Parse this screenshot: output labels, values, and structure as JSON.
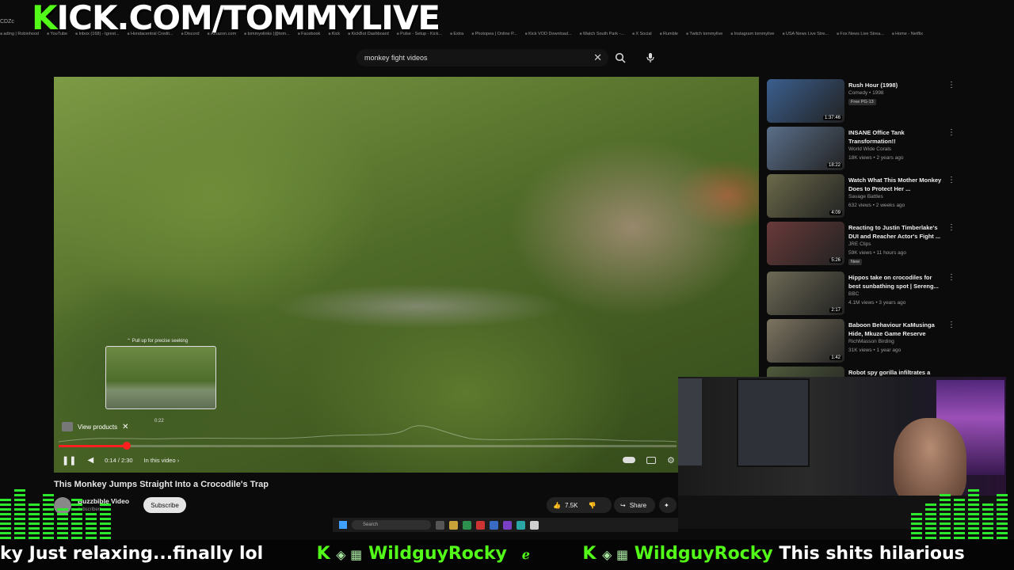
{
  "overlay": {
    "brand_k": "K",
    "brand_rest": "ICK.COM/TOMMYLIVE",
    "corner_text": "CDZc"
  },
  "bookmarks": [
    "ading | Robinhood",
    "YouTube",
    "Inbox (168) - tgrest...",
    "Hondacentral Credit...",
    "Discord",
    "Amazon.com",
    "tommyolinks (@tom...",
    "Facebook",
    "Kick",
    "KickBot Dashboard",
    "Pulse - Setup - Kick...",
    "Extra",
    "Photopea | Online P...",
    "Kick VOD Download...",
    "Watch South Park -...",
    "X Social",
    "Rumble",
    "Twitch tommylive",
    "Instagram tommylive",
    "USA News Live Stre...",
    "Fox News Live Strea...",
    "Home - Netflix"
  ],
  "search": {
    "query": "monkey fight videos"
  },
  "player": {
    "seek_hint": "Pull up for precise seeking",
    "preview_time": "0:22",
    "view_products": "View products",
    "time": "0:14 / 2:30",
    "chapters": "In this video",
    "progress": 0.11
  },
  "video": {
    "title": "This Monkey Jumps Straight Into a Crocodile's Trap",
    "channel": "Buzzbible Video",
    "subscribers": "subscribers",
    "subscribe_label": "Subscribe",
    "likes": "7.5K",
    "share_label": "Share"
  },
  "recommendations": [
    {
      "title": "Rush Hour (1998)",
      "meta1": "Comedy • 1998",
      "badge": "Free   PG-13",
      "duration": "1:37:46",
      "color": "#3b5f8f"
    },
    {
      "title": "INSANE Office Tank Transformation!!",
      "meta1": "World Wide Corals",
      "meta2": "18K views • 2 years ago",
      "duration": "18:22",
      "color": "#5a6f8a"
    },
    {
      "title": "Watch What This Mother Monkey Does to Protect Her ...",
      "meta1": "Savage Battles",
      "meta2": "632 views • 2 weeks ago",
      "duration": "4:09",
      "color": "#6b6a4a"
    },
    {
      "title": "Reacting to Justin Timberlake's DUI and Reacher Actor's Fight ...",
      "meta1": "JRE Clips",
      "meta2": "59K views • 11 hours ago",
      "badge": "New",
      "duration": "5:26",
      "color": "#6a3a3a"
    },
    {
      "title": "Hippos take on crocodiles for best sunbathing spot | Sereng...",
      "meta1": "BBC",
      "meta2": "4.1M views • 3 years ago",
      "duration": "2:17",
      "color": "#6d6a55"
    },
    {
      "title": "Baboon Behaviour  KaMusinga Hide, Mkuze Game Reserve",
      "meta1": "RichMasson Birding",
      "meta2": "31K views • 1 year ago",
      "duration": "1:42",
      "color": "#7c7460"
    },
    {
      "title": "Robot spy gorilla infiltrates a",
      "color": "#4f5a3a"
    }
  ],
  "taskbar": {
    "search": "Search"
  },
  "ticker": {
    "msg1": "ky Just relaxing...finally lol",
    "user1": "WildguyRocky",
    "user2": "WildguyRocky",
    "msg2": "This shits hilarious"
  },
  "colors": {
    "kick_green": "#53fc18",
    "progress_red": "#ff1f1f"
  }
}
